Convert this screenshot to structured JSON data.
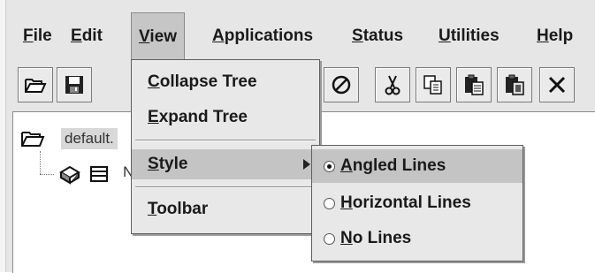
{
  "menubar": {
    "items": [
      {
        "label": "File",
        "underline": "F",
        "rest": "ile"
      },
      {
        "label": "Edit",
        "underline": "E",
        "rest": "dit"
      },
      {
        "label": "View",
        "underline": "V",
        "rest": "iew"
      },
      {
        "label": "Applications",
        "underline": "A",
        "rest": "pplications"
      },
      {
        "label": "Status",
        "underline": "S",
        "rest": "tatus"
      },
      {
        "label": "Utilities",
        "underline": "U",
        "rest": "tilities"
      },
      {
        "label": "Help",
        "underline": "H",
        "rest": "elp"
      }
    ],
    "active": "View"
  },
  "toolbar": {
    "icons": [
      "open-folder-icon",
      "save-icon",
      "stop-icon",
      "cut-icon",
      "copy-icon",
      "paste-icon",
      "paste-special-icon",
      "delete-icon"
    ]
  },
  "view_menu": {
    "items": [
      {
        "underline": "C",
        "rest": "ollapse Tree"
      },
      {
        "underline": "E",
        "rest": "xpand Tree"
      },
      {
        "underline": "S",
        "rest": "tyle"
      },
      {
        "underline": "T",
        "rest": "oolbar"
      }
    ]
  },
  "style_submenu": {
    "items": [
      {
        "underline": "A",
        "rest": "ngled Lines",
        "selected": true
      },
      {
        "underline": "H",
        "rest": "orizontal Lines",
        "selected": false
      },
      {
        "underline": "N",
        "rest": "o Lines",
        "selected": false
      }
    ]
  },
  "tree": {
    "root_label": "default.",
    "child_label": "N"
  }
}
